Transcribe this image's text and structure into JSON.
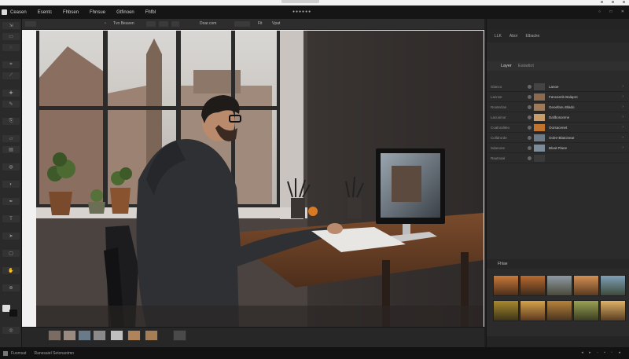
{
  "menubar": {
    "menus": [
      "Ceasen",
      "Esentc",
      "Fhbsen",
      "Fhnsue",
      "Gtfinoen",
      "Fhfbl"
    ],
    "center_dots": "●●●●●●",
    "controls": [
      "○",
      "□",
      "✕"
    ]
  },
  "optbar": {
    "left_label": "Tvo  Beaven",
    "mid_label": "Doar.com",
    "fit_label": "Fit",
    "zoom_label": "Vpat"
  },
  "status": {
    "texts": [
      "Fuomsat",
      "Ranesaiel Setonaotmn"
    ],
    "right": "◂ ▸ ◦ ▪ ▫ ◂"
  },
  "rightpanel": {
    "tabs": [
      "LLK",
      "Abor",
      "Elbacke"
    ],
    "layers_title": "Layer",
    "layers_sub": "Ealadiot",
    "layers": [
      {
        "label": "Glanco",
        "name": "Lanoe",
        "thumb": "#444444"
      },
      {
        "label": "Lacnse",
        "name": "Fanceenb Balapre",
        "thumb": "#8a6b52"
      },
      {
        "label": "Rooteclan",
        "name": "Geoefanu Blado",
        "thumb": "#9d7a5c"
      },
      {
        "label": "Lacuoinor",
        "name": "Dallbosonme",
        "thumb": "#c99d6a"
      },
      {
        "label": "Coalnraliteo",
        "name": "Oorsacenet",
        "thumb": "#c0742e"
      },
      {
        "label": "Colldrorde",
        "name": "Oolre-Blatcinear",
        "thumb": "#6e7b88"
      },
      {
        "label": "Sdanone",
        "name": "Bloat Plane",
        "thumb": "#7e8b99"
      },
      {
        "label": "Rautnaal",
        "name": "",
        "thumb": "#3a3a3a"
      }
    ],
    "gallery_title": "Fhlae",
    "gallery_colors": [
      "#c97a3a",
      "#b86a2f",
      "#8e9aa4",
      "#d49052",
      "#7fa0b8",
      "#a9892e",
      "#d6a24a",
      "#b7833b",
      "#9aa153",
      "#e0b266"
    ]
  },
  "colors": {
    "accent": "#2b2b2b",
    "canvas_frame": "#f1f1f1"
  }
}
